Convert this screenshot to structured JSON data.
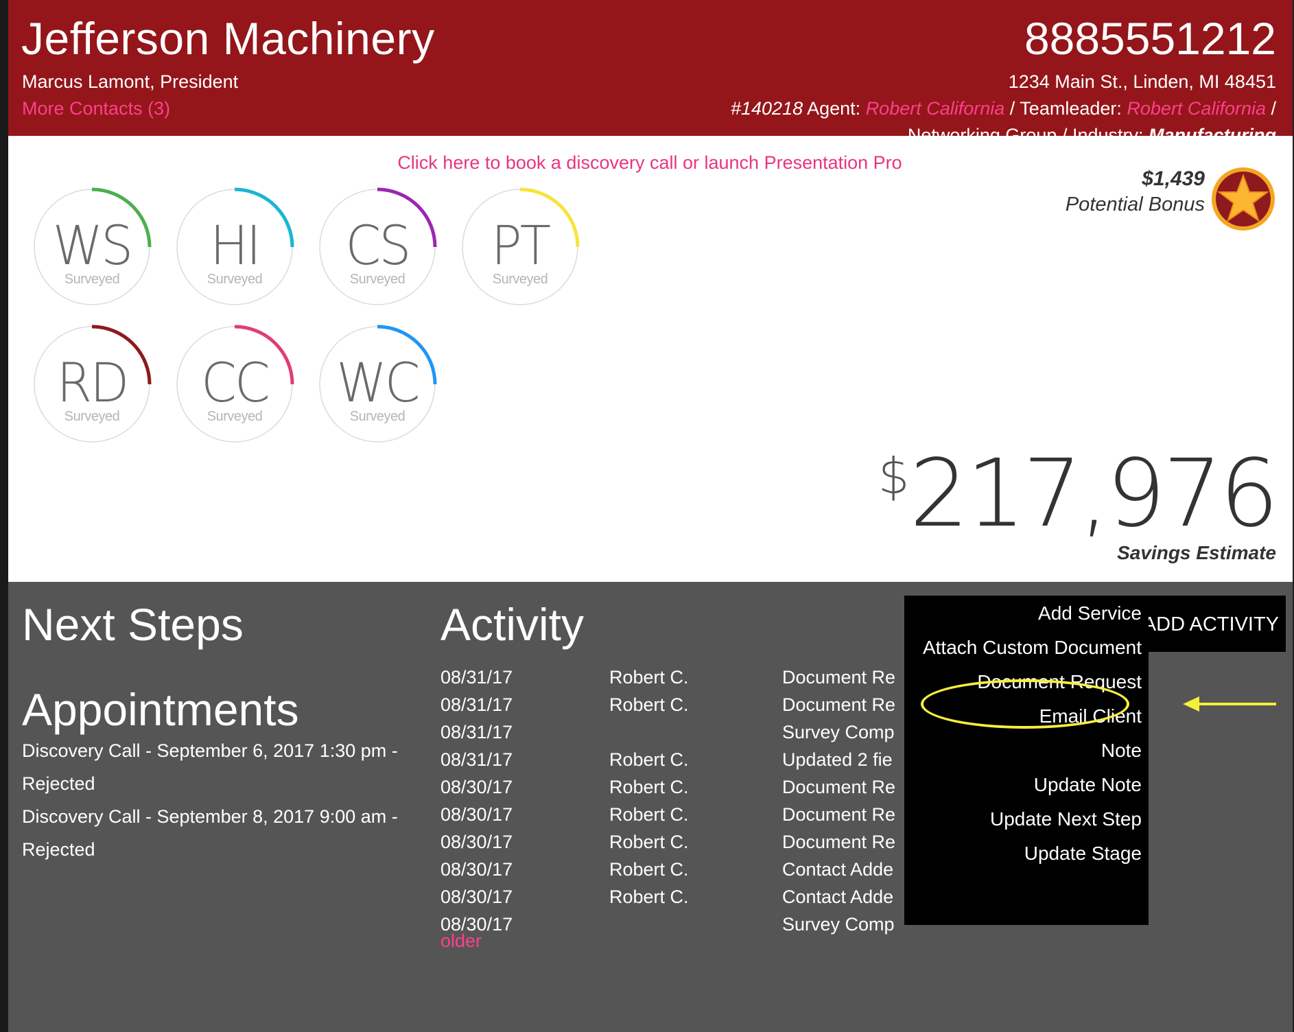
{
  "header": {
    "company": "Jefferson Machinery",
    "contact": "Marcus Lamont, President",
    "more_contacts": "More Contacts (3)",
    "phone": "8885551212",
    "address": "1234 Main St., Linden, MI 48451",
    "id": "#140218",
    "agent_label": " Agent: ",
    "agent": "Robert California",
    "teamleader_label": " / Teamleader: ",
    "teamleader": "Robert California",
    "trailing_sep": " /",
    "networking": "Networking Group / Industry: ",
    "industry": "Manufacturing"
  },
  "book_link": "Click here to book a discovery call or launch Presentation Pro",
  "gauges": [
    {
      "abbr": "WS",
      "sub": "Surveyed",
      "color": "#4caf50"
    },
    {
      "abbr": "HI",
      "sub": "Surveyed",
      "color": "#19b6d2"
    },
    {
      "abbr": "CS",
      "sub": "Surveyed",
      "color": "#9c27b0"
    },
    {
      "abbr": "PT",
      "sub": "Surveyed",
      "color": "#f7e43b"
    },
    {
      "abbr": "RD",
      "sub": "Surveyed",
      "color": "#8e1a1e"
    },
    {
      "abbr": "CC",
      "sub": "Surveyed",
      "color": "#e23d74"
    },
    {
      "abbr": "WC",
      "sub": "Surveyed",
      "color": "#2196f3"
    }
  ],
  "bonus": {
    "amount": "$1,439",
    "label": "Potential Bonus"
  },
  "savings": {
    "dollar": "$",
    "amount": "217,976",
    "label": "Savings Estimate"
  },
  "next_steps": {
    "title": "Next Steps"
  },
  "appointments": {
    "title": "Appointments",
    "items": [
      "Discovery Call - September 6, 2017 1:30 pm - Rejected",
      "Discovery Call - September 8, 2017 9:00 am - Rejected"
    ]
  },
  "activity": {
    "title": "Activity",
    "rows": [
      {
        "date": "08/31/17",
        "user": "Robert C.",
        "text": "Document Re"
      },
      {
        "date": "08/31/17",
        "user": "Robert C.",
        "text": "Document Re"
      },
      {
        "date": "08/31/17",
        "user": "",
        "text": "Survey Comp"
      },
      {
        "date": "08/31/17",
        "user": "Robert C.",
        "text": "Updated 2 fie"
      },
      {
        "date": "08/30/17",
        "user": "Robert C.",
        "text": "Document Re"
      },
      {
        "date": "08/30/17",
        "user": "Robert C.",
        "text": "Document Re"
      },
      {
        "date": "08/30/17",
        "user": "Robert C.",
        "text": "Document Re"
      },
      {
        "date": "08/30/17",
        "user": "Robert C.",
        "text": "Contact Adde"
      },
      {
        "date": "08/30/17",
        "user": "Robert C.",
        "text": "Contact Adde"
      },
      {
        "date": "08/30/17",
        "user": "",
        "text": "Survey Comp"
      }
    ],
    "older": "older"
  },
  "add_activity": {
    "label": "ADD ACTIVITY",
    "items": [
      "Add Service",
      "Attach Custom Document",
      "Document Request",
      "Email Client",
      "Note",
      "Update Note",
      "Update Next Step",
      "Update Stage"
    ]
  },
  "colors": {
    "header_bg": "#94161a",
    "accent_link": "#ff3f8e",
    "grey_bg": "#555555",
    "annotation": "#f4ef3c"
  }
}
